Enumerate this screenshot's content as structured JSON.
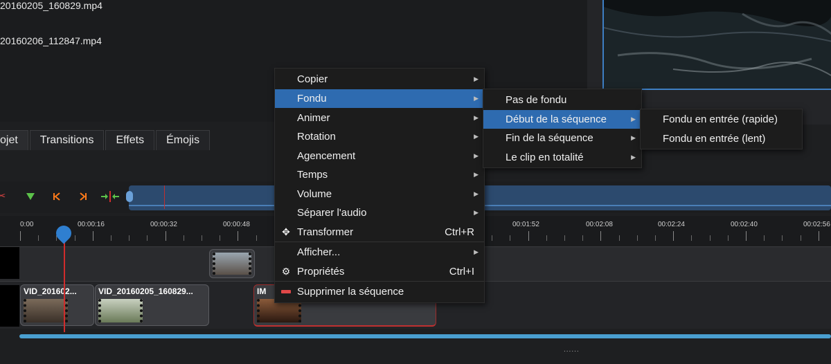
{
  "files": [
    "20160205_160829.mp4",
    "20160206_112847.mp4"
  ],
  "tabs": [
    "ojet",
    "Transitions",
    "Effets",
    "Émojis"
  ],
  "ruler": [
    "0:00",
    "00:00:16",
    "00:00:32",
    "00:00:48",
    "00:01:52",
    "00:02:08",
    "00:02:24",
    "00:02:40",
    "00:02:56"
  ],
  "clips": [
    "VID_201602...",
    "VID_20160205_160829...",
    "IM"
  ],
  "context_menu": {
    "items": [
      {
        "label": "Copier",
        "shortcut": ""
      },
      {
        "label": "Fondu",
        "shortcut": ""
      },
      {
        "label": "Animer",
        "shortcut": ""
      },
      {
        "label": "Rotation",
        "shortcut": ""
      },
      {
        "label": "Agencement",
        "shortcut": ""
      },
      {
        "label": "Temps",
        "shortcut": ""
      },
      {
        "label": "Volume",
        "shortcut": ""
      },
      {
        "label": "Séparer l'audio",
        "shortcut": ""
      },
      {
        "label": "Transformer",
        "shortcut": "Ctrl+R"
      },
      {
        "label": "Afficher...",
        "shortcut": ""
      },
      {
        "label": "Propriétés",
        "shortcut": "Ctrl+I"
      },
      {
        "label": "Supprimer la séquence",
        "shortcut": ""
      }
    ]
  },
  "fade_submenu": [
    "Pas de fondu",
    "Début de la séquence",
    "Fin de la séquence",
    "Le clip en totalité"
  ],
  "start_submenu": [
    "Fondu en entrée (rapide)",
    "Fondu en entrée (lent)"
  ],
  "colors": {
    "highlight": "#2e6bb0",
    "playhead": "#d02c2c",
    "accent": "#4a9fd0"
  }
}
